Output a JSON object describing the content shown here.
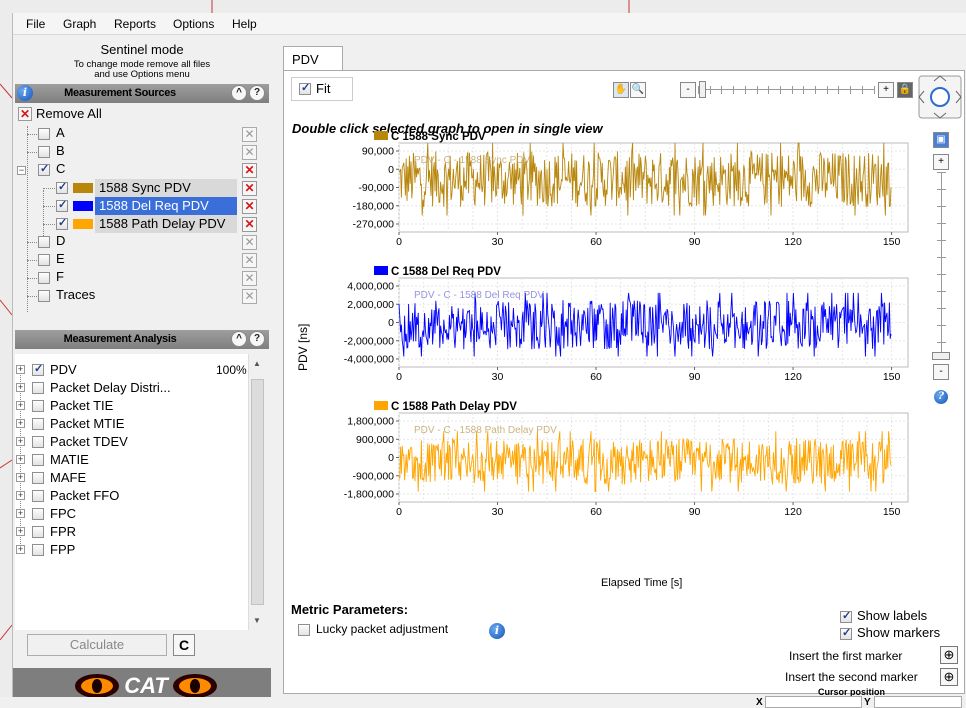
{
  "menu": [
    "File",
    "Graph",
    "Reports",
    "Options",
    "Help"
  ],
  "left": {
    "mode_title": "Sentinel mode",
    "mode_sub1": "To change mode remove all files",
    "mode_sub2": "and use Options menu",
    "sources_header": "Measurement Sources",
    "collapse_glyph": "^",
    "help_glyph": "?",
    "remove_all": "Remove All",
    "sources": [
      {
        "label": "A",
        "checked": false,
        "removable": false
      },
      {
        "label": "B",
        "checked": false,
        "removable": false
      },
      {
        "label": "C",
        "checked": true,
        "removable": true
      },
      {
        "label": "1588 Sync PDV",
        "checked": true,
        "color": "#b8860b"
      },
      {
        "label": "1588 Del Req PDV",
        "checked": true,
        "color": "#0000ff",
        "selected": true
      },
      {
        "label": "1588 Path Delay PDV",
        "checked": true,
        "color": "#ffa500"
      },
      {
        "label": "D",
        "checked": false
      },
      {
        "label": "E",
        "checked": false
      },
      {
        "label": "F",
        "checked": false
      },
      {
        "label": "Traces",
        "checked": false
      }
    ],
    "analysis_header": "Measurement Analysis",
    "analysis": [
      {
        "label": "PDV",
        "checked": true,
        "pct": "100%"
      },
      {
        "label": "Packet Delay Distri...",
        "checked": false
      },
      {
        "label": "Packet TIE",
        "checked": false
      },
      {
        "label": "Packet MTIE",
        "checked": false
      },
      {
        "label": "Packet TDEV",
        "checked": false
      },
      {
        "label": "MATIE",
        "checked": false
      },
      {
        "label": "MAFE",
        "checked": false
      },
      {
        "label": "Packet FFO",
        "checked": false
      },
      {
        "label": "FPC",
        "checked": false
      },
      {
        "label": "FPR",
        "checked": false
      },
      {
        "label": "FPP",
        "checked": false
      }
    ],
    "calculate": "Calculate",
    "logo_text": "CAT"
  },
  "right": {
    "tab": "PDV",
    "fit_label": "Fit",
    "hint": "Double click selected graph to open in single view",
    "ylabel": "PDV [ns]",
    "xlabel": "Elapsed Time [s]",
    "metric_params": "Metric Parameters:",
    "lucky_packet": "Lucky packet adjustment",
    "show_labels": "Show labels",
    "show_markers": "Show markers",
    "insert_first": "Insert the first marker",
    "insert_second": "Insert the second marker",
    "cursor_position": "Cursor position",
    "cursor_x_label": "X",
    "cursor_y_label": "Y",
    "cursor_x": "",
    "cursor_y": "",
    "zoom_plus": "+",
    "zoom_minus": "-"
  },
  "chart_data": [
    {
      "type": "line",
      "title": "C  1588 Sync PDV",
      "color": "#b8860b",
      "inner_label": "PDV - C - 1588 Sync PDV",
      "x_ticks": [
        0,
        30,
        60,
        90,
        120,
        150
      ],
      "y_ticks": [
        "90,000",
        "0",
        "-90,000",
        "-180,000",
        "-270,000"
      ],
      "xlim": [
        0,
        155
      ],
      "ylim": [
        -300000,
        130000
      ],
      "band": [
        -180000,
        90000
      ],
      "xlabel": "Elapsed Time [s]",
      "ylabel": "PDV [ns]"
    },
    {
      "type": "line",
      "title": "C  1588 Del Req PDV",
      "color": "#0000ff",
      "inner_label": "PDV - C - 1588 Del Req PDV",
      "x_ticks": [
        0,
        30,
        60,
        90,
        120,
        150
      ],
      "y_ticks": [
        "4,000,000",
        "2,000,000",
        "0",
        "-2,000,000",
        "-4,000,000"
      ],
      "xlim": [
        0,
        155
      ],
      "ylim": [
        -5000000,
        5000000
      ],
      "band": [
        -3000000,
        2500000
      ],
      "xlabel": "Elapsed Time [s]",
      "ylabel": "PDV [ns]"
    },
    {
      "type": "line",
      "title": "C  1588 Path Delay PDV",
      "color": "#ffa500",
      "inner_label": "PDV - C - 1588 Path Delay PDV",
      "x_ticks": [
        0,
        30,
        60,
        90,
        120,
        150
      ],
      "y_ticks": [
        "1,800,000",
        "900,000",
        "0",
        "-900,000",
        "-1,800,000"
      ],
      "xlim": [
        0,
        155
      ],
      "ylim": [
        -2300000,
        2300000
      ],
      "band": [
        -1400000,
        1000000
      ],
      "xlabel": "Elapsed Time [s]",
      "ylabel": "PDV [ns]"
    }
  ]
}
